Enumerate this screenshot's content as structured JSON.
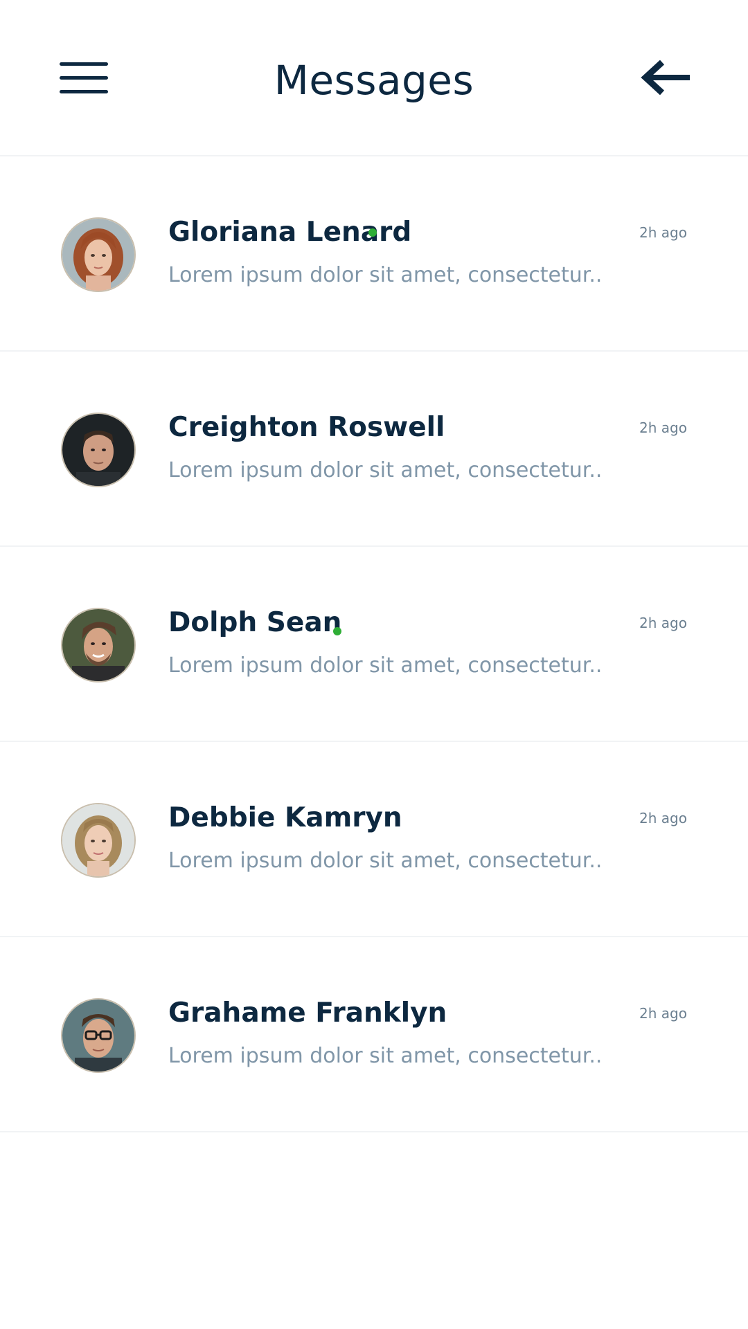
{
  "header": {
    "title": "Messages",
    "menu_icon": "hamburger-menu-icon",
    "back_icon": "arrow-left-icon"
  },
  "colors": {
    "text_primary": "#0d2840",
    "text_secondary": "#8096a8",
    "online": "#2fae36",
    "divider": "#f1f3f5"
  },
  "conversations": [
    {
      "name": "Gloriana Lenard",
      "online": true,
      "preview": "Lorem ipsum dolor sit amet, consectetur..",
      "time": "2h ago"
    },
    {
      "name": "Creighton Roswell",
      "online": false,
      "preview": "Lorem ipsum dolor sit amet, consectetur..",
      "time": "2h ago"
    },
    {
      "name": "Dolph Sean",
      "online": true,
      "preview": "Lorem ipsum dolor sit amet, consectetur..",
      "time": "2h ago"
    },
    {
      "name": "Debbie Kamryn",
      "online": false,
      "preview": "Lorem ipsum dolor sit amet, consectetur..",
      "time": "2h ago"
    },
    {
      "name": "Grahame Franklyn",
      "online": false,
      "preview": "Lorem ipsum dolor sit amet, consectetur..",
      "time": "2h ago"
    }
  ]
}
